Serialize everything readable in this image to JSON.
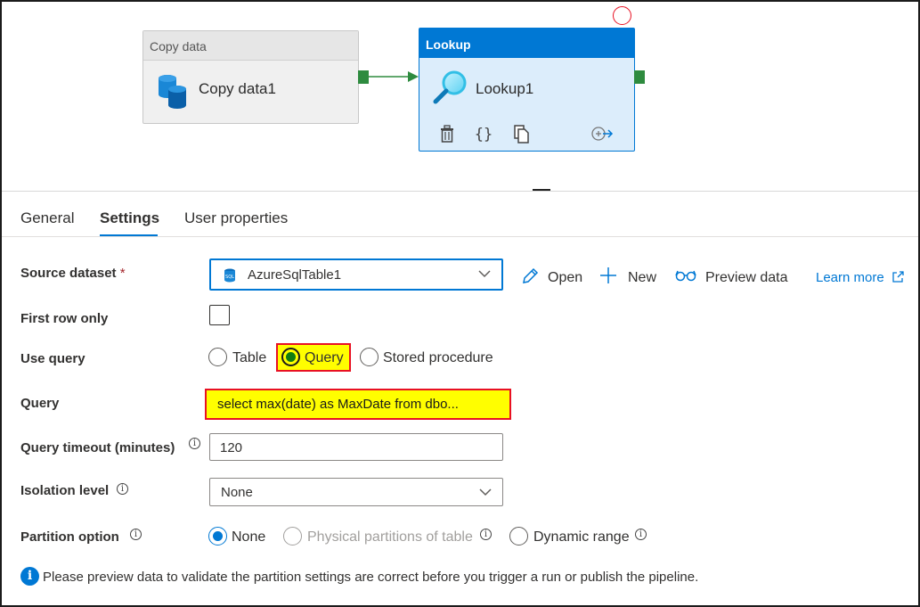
{
  "canvas": {
    "copy_node": {
      "header": "Copy data",
      "name": "Copy data1",
      "icon": "database-icon"
    },
    "lookup_node": {
      "header": "Lookup",
      "name": "Lookup1",
      "icon": "magnifier-icon",
      "actions": [
        "delete-icon",
        "code-icon",
        "clone-icon",
        "add-output-icon"
      ]
    }
  },
  "tabs": [
    {
      "label": "General"
    },
    {
      "label": "Settings",
      "active": true
    },
    {
      "label": "User properties"
    }
  ],
  "form": {
    "source_dataset": {
      "label": "Source dataset",
      "required_mark": "*",
      "value": "AzureSqlTable1",
      "icon": "sql-icon"
    },
    "toolbar": {
      "open": "Open",
      "new": "New",
      "preview": "Preview data",
      "learn_more": "Learn more"
    },
    "first_row_only": {
      "label": "First row only",
      "checked": false
    },
    "use_query": {
      "label": "Use query",
      "options": [
        "Table",
        "Query",
        "Stored procedure"
      ],
      "selected": "Query"
    },
    "query": {
      "label": "Query",
      "value": "select max(date) as MaxDate from dbo..."
    },
    "query_timeout": {
      "label": "Query timeout (minutes)",
      "value": "120"
    },
    "isolation_level": {
      "label": "Isolation level",
      "value": "None"
    },
    "partition_option": {
      "label": "Partition option",
      "options": [
        "None",
        "Physical partitions of table",
        "Dynamic range"
      ],
      "selected": "None"
    },
    "info_message": "Please preview data to validate the partition settings are correct before you trigger a run or publish the pipeline."
  },
  "colors": {
    "accent": "#0078d4",
    "highlight": "#fffe00",
    "highlight_border": "#e81123",
    "connector": "#2e8b3f"
  }
}
